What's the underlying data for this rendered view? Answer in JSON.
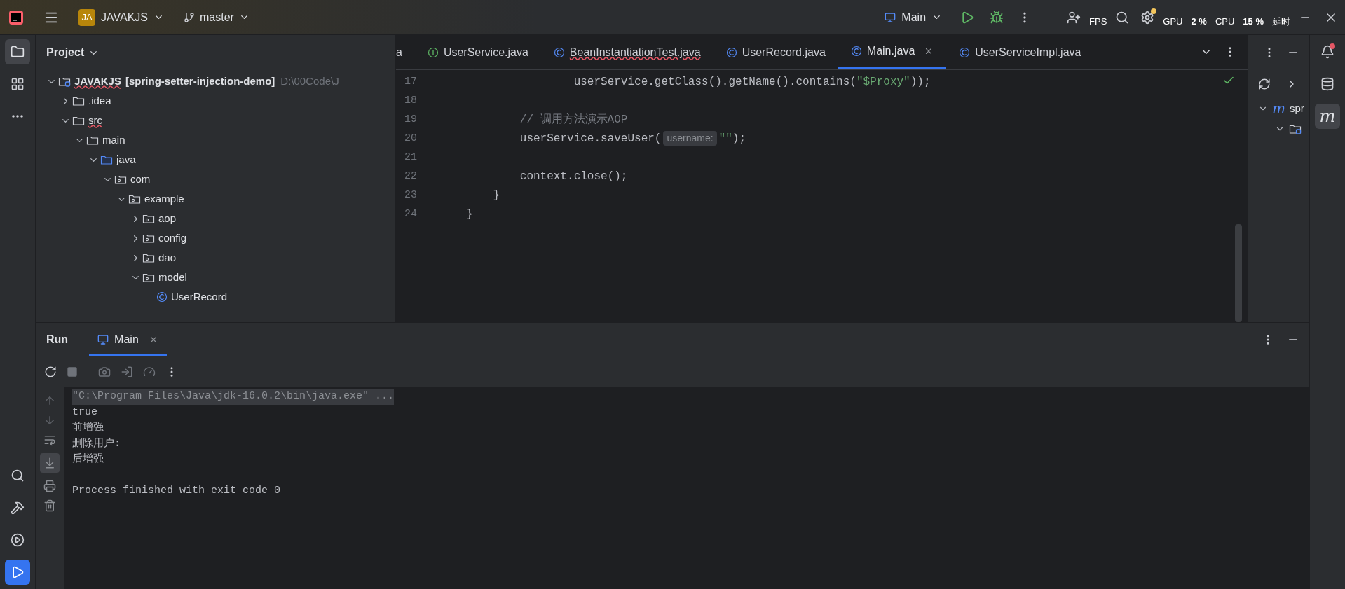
{
  "title_bar": {
    "project_badge": "JA",
    "project": "JAVAKJS",
    "branch": "master",
    "run_config": "Main",
    "overlay": [
      "FPS",
      "GPU",
      "2 %",
      "CPU",
      "15 %",
      "延时"
    ]
  },
  "left_strip": [
    {
      "kind": "folder",
      "selected": true
    },
    {
      "kind": "structure",
      "selected": false
    },
    {
      "kind": "more",
      "selected": false
    },
    {
      "kind": "search",
      "selected": false
    },
    {
      "kind": "build",
      "selected": false
    },
    {
      "kind": "services",
      "selected": false
    },
    {
      "kind": "run",
      "selected": true
    }
  ],
  "project_panel": {
    "title": "Project",
    "tree": [
      {
        "kind": "module",
        "label": "JAVAKJS",
        "suffix": "[spring-setter-injection-demo]",
        "path": "D:\\00Code\\J",
        "error": true,
        "expanded": true,
        "children": [
          {
            "kind": "folder",
            "label": ".idea",
            "expanded": false
          },
          {
            "kind": "folder",
            "label": "src",
            "error": true,
            "expanded": true,
            "children": [
              {
                "kind": "folder",
                "label": "main",
                "expanded": true,
                "children": [
                  {
                    "kind": "source_root",
                    "label": "java",
                    "expanded": true,
                    "children": [
                      {
                        "kind": "package",
                        "label": "com",
                        "expanded": true,
                        "children": [
                          {
                            "kind": "package",
                            "label": "example",
                            "expanded": true,
                            "children": [
                              {
                                "kind": "package",
                                "label": "aop",
                                "expanded": false
                              },
                              {
                                "kind": "package",
                                "label": "config",
                                "expanded": false
                              },
                              {
                                "kind": "package",
                                "label": "dao",
                                "expanded": false
                              },
                              {
                                "kind": "package",
                                "label": "model",
                                "expanded": true,
                                "children": [
                                  {
                                    "kind": "class",
                                    "label": "UserRecord"
                                  }
                                ]
                              }
                            ]
                          }
                        ]
                      }
                    ]
                  }
                ]
              }
            ]
          }
        ]
      }
    ]
  },
  "editor": {
    "tabs": [
      {
        "kind": "cut",
        "label": "a",
        "selected": false
      },
      {
        "kind": "interface",
        "label": "UserService.java",
        "selected": false
      },
      {
        "kind": "class",
        "label": "BeanInstantiationTest.java",
        "error": true,
        "selected": false
      },
      {
        "kind": "class",
        "label": "UserRecord.java",
        "selected": false
      },
      {
        "kind": "class",
        "label": "Main.java",
        "selected": true,
        "closable": true
      },
      {
        "kind": "class",
        "label": "UserServiceImpl.java",
        "selected": false
      }
    ],
    "lines": [
      {
        "number": "17",
        "tokens": [
          {
            "kind": "code",
            "text": "                userService.getClass().getName().contains("
          },
          {
            "kind": "string",
            "text": "\"$Proxy\""
          },
          {
            "kind": "code",
            "text": "));"
          }
        ]
      },
      {
        "number": "18"
      },
      {
        "number": "19",
        "tokens": [
          {
            "kind": "comment",
            "text": "        // 调用方法演示AOP"
          }
        ]
      },
      {
        "number": "20",
        "tokens": [
          {
            "kind": "code",
            "text": "        userService.saveUser("
          },
          {
            "kind": "hint",
            "text": "username:"
          },
          {
            "kind": "string",
            "text": "\"\""
          },
          {
            "kind": "code",
            "text": ");"
          }
        ]
      },
      {
        "number": "21"
      },
      {
        "number": "22",
        "tokens": [
          {
            "kind": "code",
            "text": "        context.close();"
          }
        ]
      },
      {
        "number": "23",
        "tokens": [
          {
            "kind": "code",
            "text": "    }"
          }
        ]
      },
      {
        "number": "24",
        "tokens": [
          {
            "kind": "code",
            "text": "}"
          }
        ]
      }
    ]
  },
  "maven_panel": {
    "root_icon": "m",
    "root": "spr"
  },
  "right_strip": [
    {
      "kind": "notifications",
      "selected": false,
      "badge": true
    },
    {
      "kind": "database",
      "selected": false
    },
    {
      "kind": "maven",
      "glyph": "m",
      "selected": true
    }
  ],
  "run_panel": {
    "title": "Run",
    "tabs": [
      {
        "label": "Main",
        "selected": true
      }
    ],
    "console": [
      {
        "kind": "command",
        "text": "\"C:\\Program Files\\Java\\jdk-16.0.2\\bin\\java.exe\" ..."
      },
      {
        "kind": "output",
        "text": "true"
      },
      {
        "kind": "output",
        "text": "前增强"
      },
      {
        "kind": "output",
        "text": "删除用户:"
      },
      {
        "kind": "output",
        "text": "后增强"
      },
      {
        "kind": "blank"
      },
      {
        "kind": "output",
        "text": "Process finished with exit code 0"
      }
    ]
  }
}
